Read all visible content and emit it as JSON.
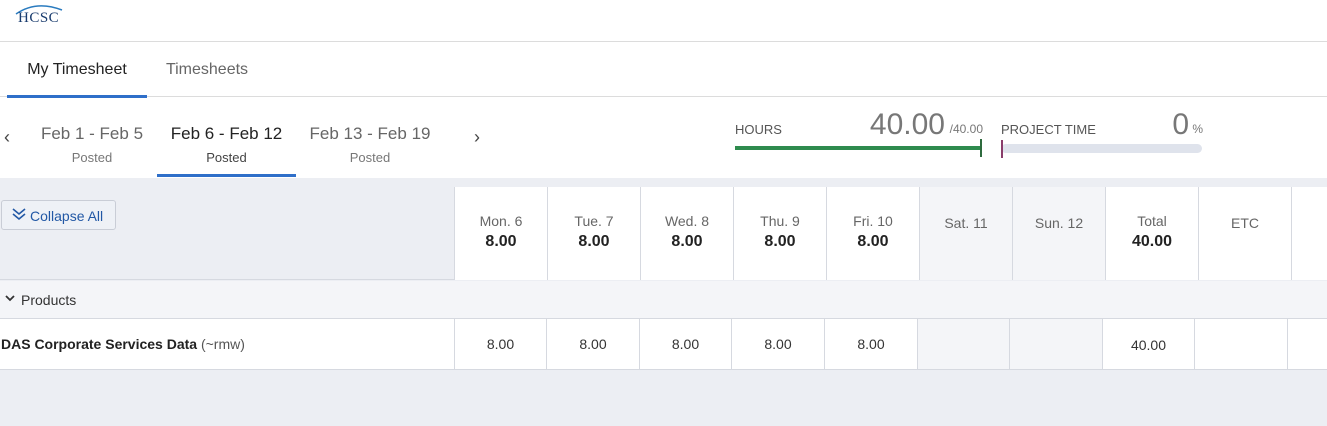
{
  "brand": {
    "logo_text": "HCSC"
  },
  "tabs": [
    {
      "label": "My Timesheet",
      "active": true
    },
    {
      "label": "Timesheets",
      "active": false
    }
  ],
  "week_nav": {
    "prev_icon": "chevron-left-icon",
    "next_icon": "chevron-right-icon",
    "weeks": [
      {
        "range": "Feb 1 - Feb 5",
        "status": "Posted"
      },
      {
        "range": "Feb 6 - Feb 12",
        "status": "Posted",
        "active": true
      },
      {
        "range": "Feb 13 - Feb 19",
        "status": "Posted"
      }
    ]
  },
  "summary": {
    "hours_label": "HOURS",
    "hours_value": "40.00",
    "hours_target": "/40.00",
    "hours_fraction": 1.0,
    "project_label": "PROJECT TIME",
    "project_value": "0",
    "project_unit": "%",
    "project_fraction": 0.0,
    "colors": {
      "hours_bar": "#2e8b4e",
      "accent": "#2f6fc9"
    }
  },
  "grid": {
    "collapse_label": "Collapse All",
    "days": [
      {
        "name": "Mon. 6",
        "hours": "8.00"
      },
      {
        "name": "Tue. 7",
        "hours": "8.00"
      },
      {
        "name": "Wed. 8",
        "hours": "8.00"
      },
      {
        "name": "Thu. 9",
        "hours": "8.00"
      },
      {
        "name": "Fri. 10",
        "hours": "8.00"
      },
      {
        "name": "Sat. 11",
        "hours": ""
      },
      {
        "name": "Sun. 12",
        "hours": ""
      }
    ],
    "total": {
      "name": "Total",
      "hours": "40.00"
    },
    "etc": {
      "name": "ETC"
    },
    "group": {
      "label": "Products"
    },
    "rows": [
      {
        "project": "DAS Corporate Services Data",
        "code": "(~rmw)",
        "values": [
          "8.00",
          "8.00",
          "8.00",
          "8.00",
          "8.00",
          "",
          ""
        ],
        "total": "40.00",
        "etc": ""
      }
    ]
  }
}
